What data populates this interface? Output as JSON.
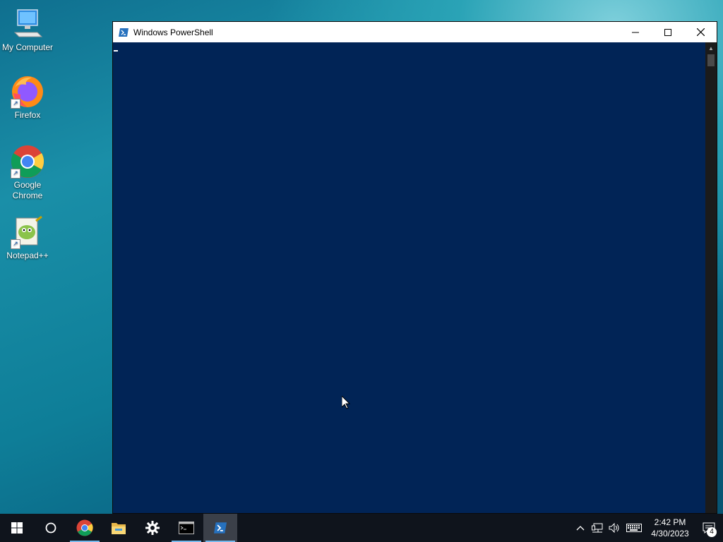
{
  "desktop": {
    "icons": [
      {
        "label": "My Computer"
      },
      {
        "label": "Firefox"
      },
      {
        "label": "Google Chrome"
      },
      {
        "label": "Notepad++"
      }
    ]
  },
  "window": {
    "title": "Windows PowerShell",
    "background_color": "#012456"
  },
  "taskbar": {
    "apps": [
      "start-button",
      "search-button",
      "chrome",
      "file-explorer",
      "settings",
      "command-prompt",
      "powershell"
    ],
    "clock": {
      "time": "2:42 PM",
      "date": "4/30/2023"
    },
    "notification_count": "4"
  }
}
